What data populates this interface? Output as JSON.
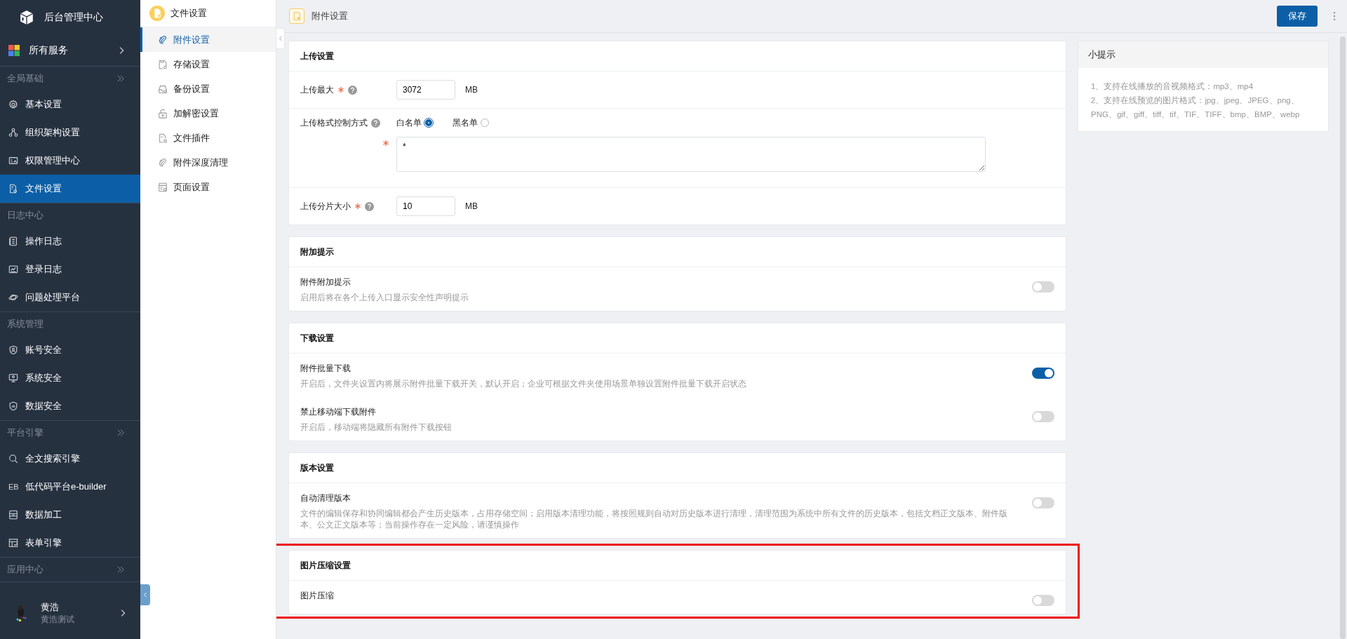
{
  "app": {
    "title": "后台管理中心"
  },
  "all_services": {
    "label": "所有服务"
  },
  "sidebar": {
    "groups": [
      {
        "title": "全局基础",
        "collapsible": true,
        "items": [
          {
            "label": "基本设置",
            "selected": false
          },
          {
            "label": "组织架构设置",
            "selected": false
          },
          {
            "label": "权限管理中心",
            "selected": false
          },
          {
            "label": "文件设置",
            "selected": true
          }
        ]
      },
      {
        "title": "日志中心",
        "collapsible": false,
        "items": [
          {
            "label": "操作日志",
            "selected": false
          },
          {
            "label": "登录日志",
            "selected": false
          },
          {
            "label": "问题处理平台",
            "selected": false
          }
        ]
      },
      {
        "title": "系统管理",
        "collapsible": false,
        "items": [
          {
            "label": "账号安全",
            "selected": false
          },
          {
            "label": "系统安全",
            "selected": false
          },
          {
            "label": "数据安全",
            "selected": false
          }
        ]
      },
      {
        "title": "平台引擎",
        "collapsible": true,
        "items": [
          {
            "label": "全文搜索引擎",
            "selected": false
          },
          {
            "label": "低代码平台e-builder",
            "icon_text": "EB",
            "selected": false
          },
          {
            "label": "数据加工",
            "selected": false
          },
          {
            "label": "表单引擎",
            "selected": false
          }
        ]
      },
      {
        "title": "应用中心",
        "collapsible": true
      }
    ]
  },
  "user": {
    "name": "黄浩",
    "subtitle": "黄浩测试"
  },
  "subnav": {
    "title": "文件设置",
    "items": [
      {
        "label": "附件设置",
        "selected": true
      },
      {
        "label": "存储设置",
        "selected": false
      },
      {
        "label": "备份设置",
        "selected": false
      },
      {
        "label": "加解密设置",
        "selected": false
      },
      {
        "label": "文件插件",
        "selected": false
      },
      {
        "label": "附件深度清理",
        "selected": false
      },
      {
        "label": "页面设置",
        "selected": false
      }
    ]
  },
  "header": {
    "title": "附件设置",
    "save_button": "保存"
  },
  "sections": [
    {
      "title": "上传设置",
      "highlighted": false,
      "rows": [
        {
          "kind": "number",
          "label": "上传最大",
          "required": true,
          "help": true,
          "value": "3072",
          "unit": "MB"
        },
        {
          "kind": "radio",
          "label": "上传格式控制方式",
          "required": false,
          "help": true,
          "options": [
            {
              "label": "白名单",
              "selected": true
            },
            {
              "label": "黑名单",
              "selected": false
            }
          ]
        },
        {
          "kind": "textarea",
          "required": true,
          "help": false,
          "value": "*"
        },
        {
          "kind": "number",
          "label": "上传分片大小",
          "required": true,
          "help": true,
          "value": "10",
          "unit": "MB"
        }
      ]
    },
    {
      "title": "附加提示",
      "highlighted": false,
      "rows": [
        {
          "kind": "toggle",
          "label": "附件附加提示",
          "description": "启用后将在各个上传入口显示安全性声明提示",
          "on": false
        }
      ]
    },
    {
      "title": "下载设置",
      "highlighted": false,
      "rows": [
        {
          "kind": "toggle",
          "label": "附件批量下载",
          "description": "开启后，文件夹设置内将展示附件批量下载开关，默认开启；企业可根据文件夹使用场景单独设置附件批量下载开启状态",
          "on": true
        },
        {
          "kind": "toggle",
          "label": "禁止移动端下载附件",
          "description": "开启后，移动端将隐藏所有附件下载按钮",
          "on": false
        }
      ]
    },
    {
      "title": "版本设置",
      "highlighted": false,
      "rows": [
        {
          "kind": "toggle",
          "label": "自动清理版本",
          "description": "文件的编辑保存和协同编辑都会产生历史版本，占用存储空间；启用版本清理功能，将按照规则自动对历史版本进行清理，清理范围为系统中所有文件的历史版本，包括文档正文版本、附件版本、公文正文版本等；当前操作存在一定风险，请谨慎操作",
          "on": false
        }
      ]
    },
    {
      "title": "图片压缩设置",
      "highlighted": true,
      "rows": [
        {
          "kind": "toggle",
          "label": "图片压缩",
          "on": false
        }
      ]
    }
  ],
  "tips": {
    "title": "小提示",
    "lines": [
      "1、支持在线播放的音视频格式：mp3、mp4",
      "2、支持在线预览的图片格式：jpg、jpeg、JPEG、png、PNG、gif、giff、tiff、tif、TIF、TIFF、bmp、BMP、webp"
    ]
  }
}
